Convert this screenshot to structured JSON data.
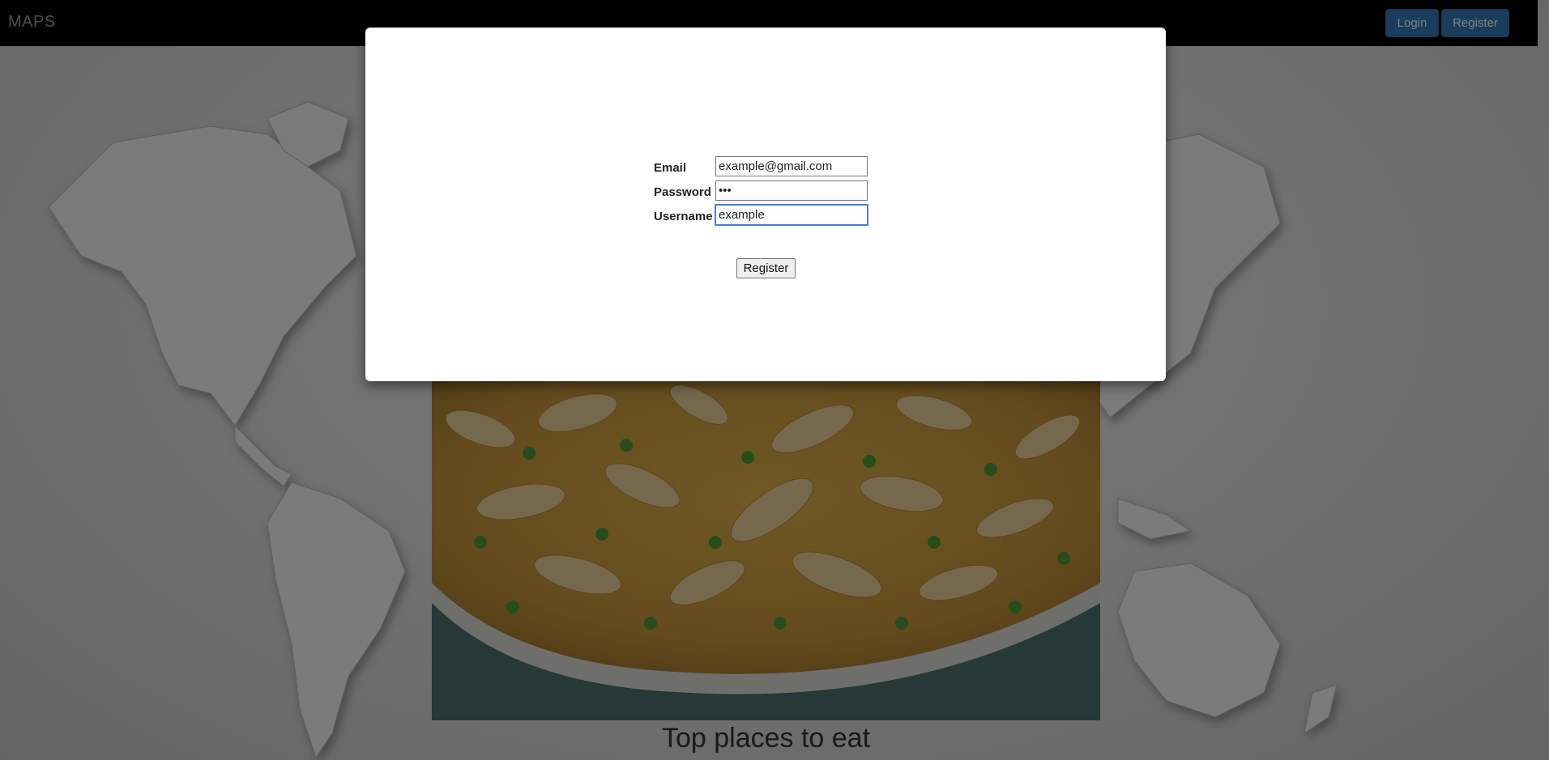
{
  "navbar": {
    "brand": "MAPS",
    "login_label": "Login",
    "register_label": "Register"
  },
  "main": {
    "caption": "Top places to eat"
  },
  "modal": {
    "form": {
      "email_label": "Email",
      "email_value": "example@gmail.com",
      "password_label": "Password",
      "password_value": "•••",
      "username_label": "Username",
      "username_value": "example",
      "submit_label": "Register"
    }
  },
  "colors": {
    "navbar_bg": "#000000",
    "brand_text": "#9d9d9d",
    "primary_button": "#337ab7",
    "overlay": "rgba(0,0,0,0.5)",
    "focus_ring": "#4a7fd4"
  }
}
